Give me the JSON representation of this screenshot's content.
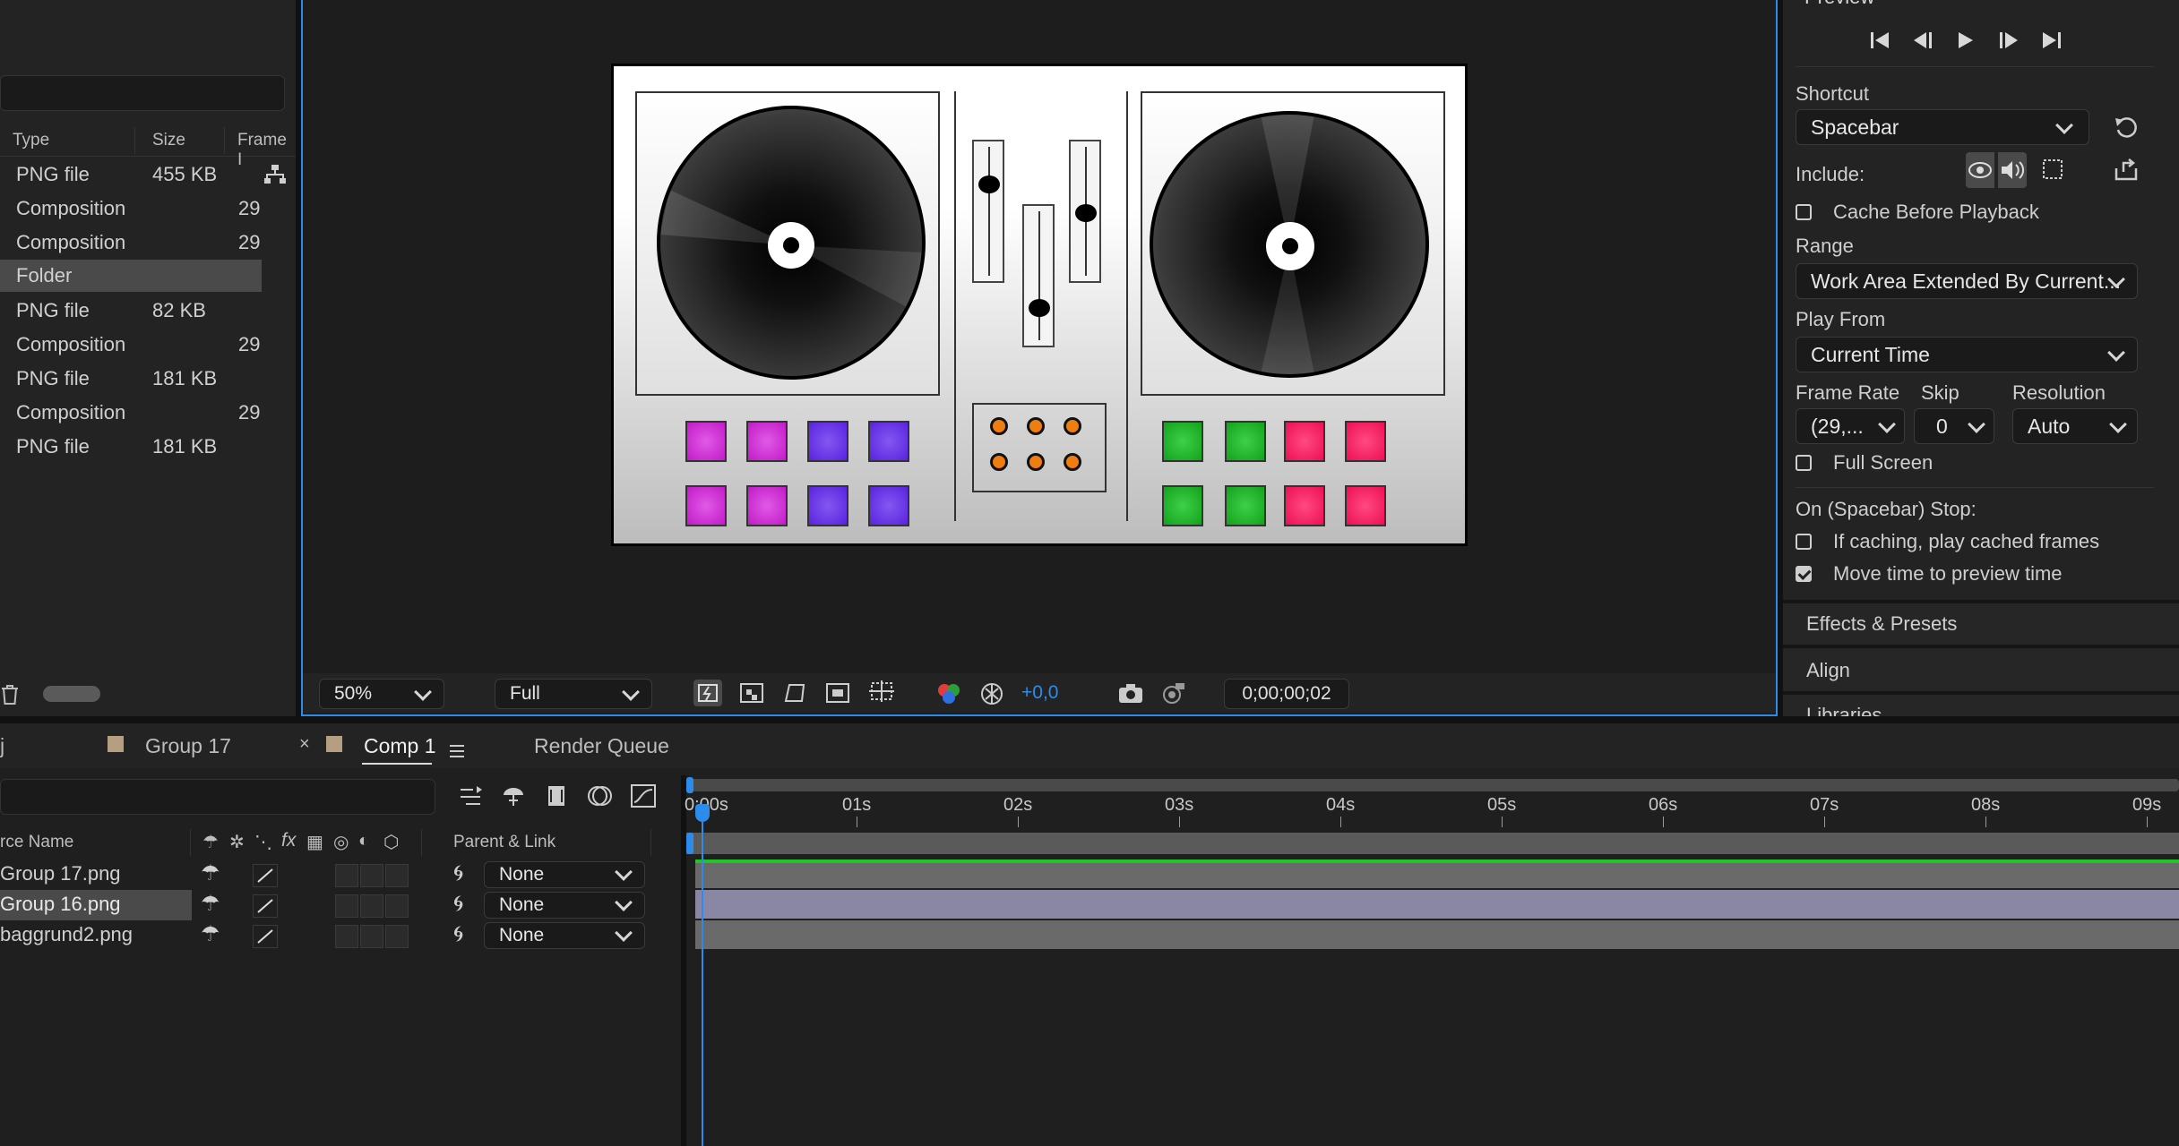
{
  "project": {
    "columns": {
      "type": "Type",
      "size": "Size",
      "frame": "Frame I"
    },
    "rows": [
      {
        "type": "PNG file",
        "size": "455 KB",
        "frame": ""
      },
      {
        "type": "Composition",
        "size": "",
        "frame": "29"
      },
      {
        "type": "Composition",
        "size": "",
        "frame": "29"
      },
      {
        "type": "Folder",
        "size": "",
        "frame": ""
      },
      {
        "type": "PNG file",
        "size": "82 KB",
        "frame": ""
      },
      {
        "type": "Composition",
        "size": "",
        "frame": "29"
      },
      {
        "type": "PNG file",
        "size": "181 KB",
        "frame": ""
      },
      {
        "type": "Composition",
        "size": "",
        "frame": "29"
      },
      {
        "type": "PNG file",
        "size": "181 KB",
        "frame": ""
      }
    ]
  },
  "viewer": {
    "zoom": "50%",
    "resolution": "Full",
    "exposure": "+0,0",
    "timecode": "0;00;00;02"
  },
  "preview": {
    "title": "Preview",
    "shortcut_label": "Shortcut",
    "shortcut_value": "Spacebar",
    "include_label": "Include:",
    "cache_before_playback": "Cache Before Playback",
    "range_label": "Range",
    "range_value": "Work Area Extended By Current...",
    "play_from_label": "Play From",
    "play_from_value": "Current Time",
    "frame_rate_label": "Frame Rate",
    "frame_rate_value": "(29,...",
    "skip_label": "Skip",
    "skip_value": "0",
    "resolution_label": "Resolution",
    "resolution_value": "Auto",
    "full_screen": "Full Screen",
    "stop_label": "On (Spacebar) Stop:",
    "if_caching": "If caching, play cached frames",
    "move_time": "Move time to preview time"
  },
  "side_panels": {
    "effects": "Effects & Presets",
    "align": "Align",
    "libraries": "Libraries"
  },
  "tabs": {
    "partial": "j",
    "group17": "Group 17",
    "comp1": "Comp 1",
    "render_queue": "Render Queue"
  },
  "timeline": {
    "source_name_header": "rce Name",
    "parent_header": "Parent & Link",
    "ruler": [
      "0:00s",
      "01s",
      "02s",
      "03s",
      "04s",
      "05s",
      "06s",
      "07s",
      "08s",
      "09s"
    ],
    "layers": [
      {
        "name": "Group 17.png",
        "parent": "None"
      },
      {
        "name": "Group 16.png",
        "parent": "None"
      },
      {
        "name": "baggrund2.png",
        "parent": "None"
      }
    ]
  },
  "colors": {
    "accent_blue": "#2d8ceb",
    "pad_magenta": "#c21ac8",
    "pad_purple": "#5a22e0",
    "pad_green": "#12a21c",
    "pad_pink": "#ee0f55",
    "knob_orange": "#f07d10"
  }
}
